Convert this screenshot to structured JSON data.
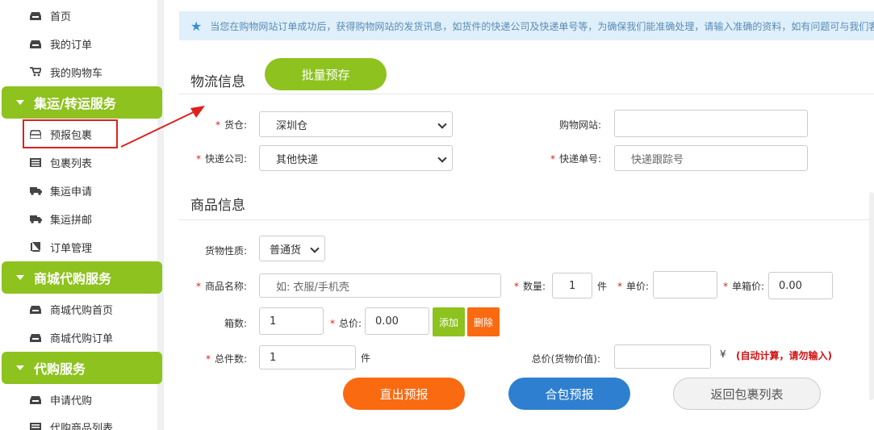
{
  "sidebar": {
    "top_items": [
      {
        "label": "首页",
        "icon": "inbox-icon"
      },
      {
        "label": "我的订单",
        "icon": "inbox-icon"
      },
      {
        "label": "我的购物车",
        "icon": "cart-icon"
      }
    ],
    "sections": [
      {
        "title": "集运/转运服务",
        "items": [
          {
            "label": "预报包裹",
            "icon": "inbox-icon"
          },
          {
            "label": "包裹列表",
            "icon": "list-icon"
          },
          {
            "label": "集运申请",
            "icon": "truck-icon"
          },
          {
            "label": "集运拼邮",
            "icon": "truck-icon"
          },
          {
            "label": "订单管理",
            "icon": "book-icon"
          }
        ]
      },
      {
        "title": "商城代购服务",
        "items": [
          {
            "label": "商城代购首页",
            "icon": "inbox-icon"
          },
          {
            "label": "商城代购订单",
            "icon": "inbox-icon"
          }
        ]
      },
      {
        "title": "代购服务",
        "items": [
          {
            "label": "申请代购",
            "icon": "inbox-icon"
          },
          {
            "label": "代购商品列表",
            "icon": "list-icon"
          }
        ]
      }
    ],
    "accent": "#8dc21f"
  },
  "notice": "当您在购物网站订单成功后，获得购物网站的发货讯息，如货件的快递公司及快递单号等，为确保我们能准确处理，请输入准确的资料，如有问题可与我们客",
  "logistics": {
    "title": "物流信息",
    "batch_button": "批量预存",
    "warehouse_label": "货仓:",
    "warehouse_value": "深圳仓",
    "site_label": "购物网站:",
    "site_value": "",
    "courier_label": "快递公司:",
    "courier_value": "其他快递",
    "tracking_label": "快递单号:",
    "tracking_placeholder": "快递跟踪号"
  },
  "goods": {
    "title": "商品信息",
    "nature_label": "货物性质:",
    "nature_value": "普通货",
    "name_label": "商品名称:",
    "name_placeholder": "如: 衣服/手机壳",
    "qty_label": "数量:",
    "qty_value": "1",
    "qty_unit": "件",
    "price_label": "单价:",
    "price_value": "",
    "box_price_label": "单箱价:",
    "box_price_value": "0.00",
    "boxes_label": "箱数:",
    "boxes_value": "1",
    "total_label": "总价:",
    "total_value": "0.00",
    "add_button": "添加",
    "delete_button": "删除",
    "total_count_label": "总件数:",
    "total_count_value": "1",
    "total_count_unit": "件",
    "goods_value_label": "总价(货物价值):",
    "goods_value": "",
    "currency": "¥",
    "auto_note": "(自动计算，请勿输入)"
  },
  "actions": {
    "direct": "直出预报",
    "combined": "合包预报",
    "back": "返回包裹列表"
  },
  "colors": {
    "green": "#8dc21f",
    "orange": "#fa6a10",
    "blue": "#2f7fd0",
    "red": "#e02020"
  }
}
